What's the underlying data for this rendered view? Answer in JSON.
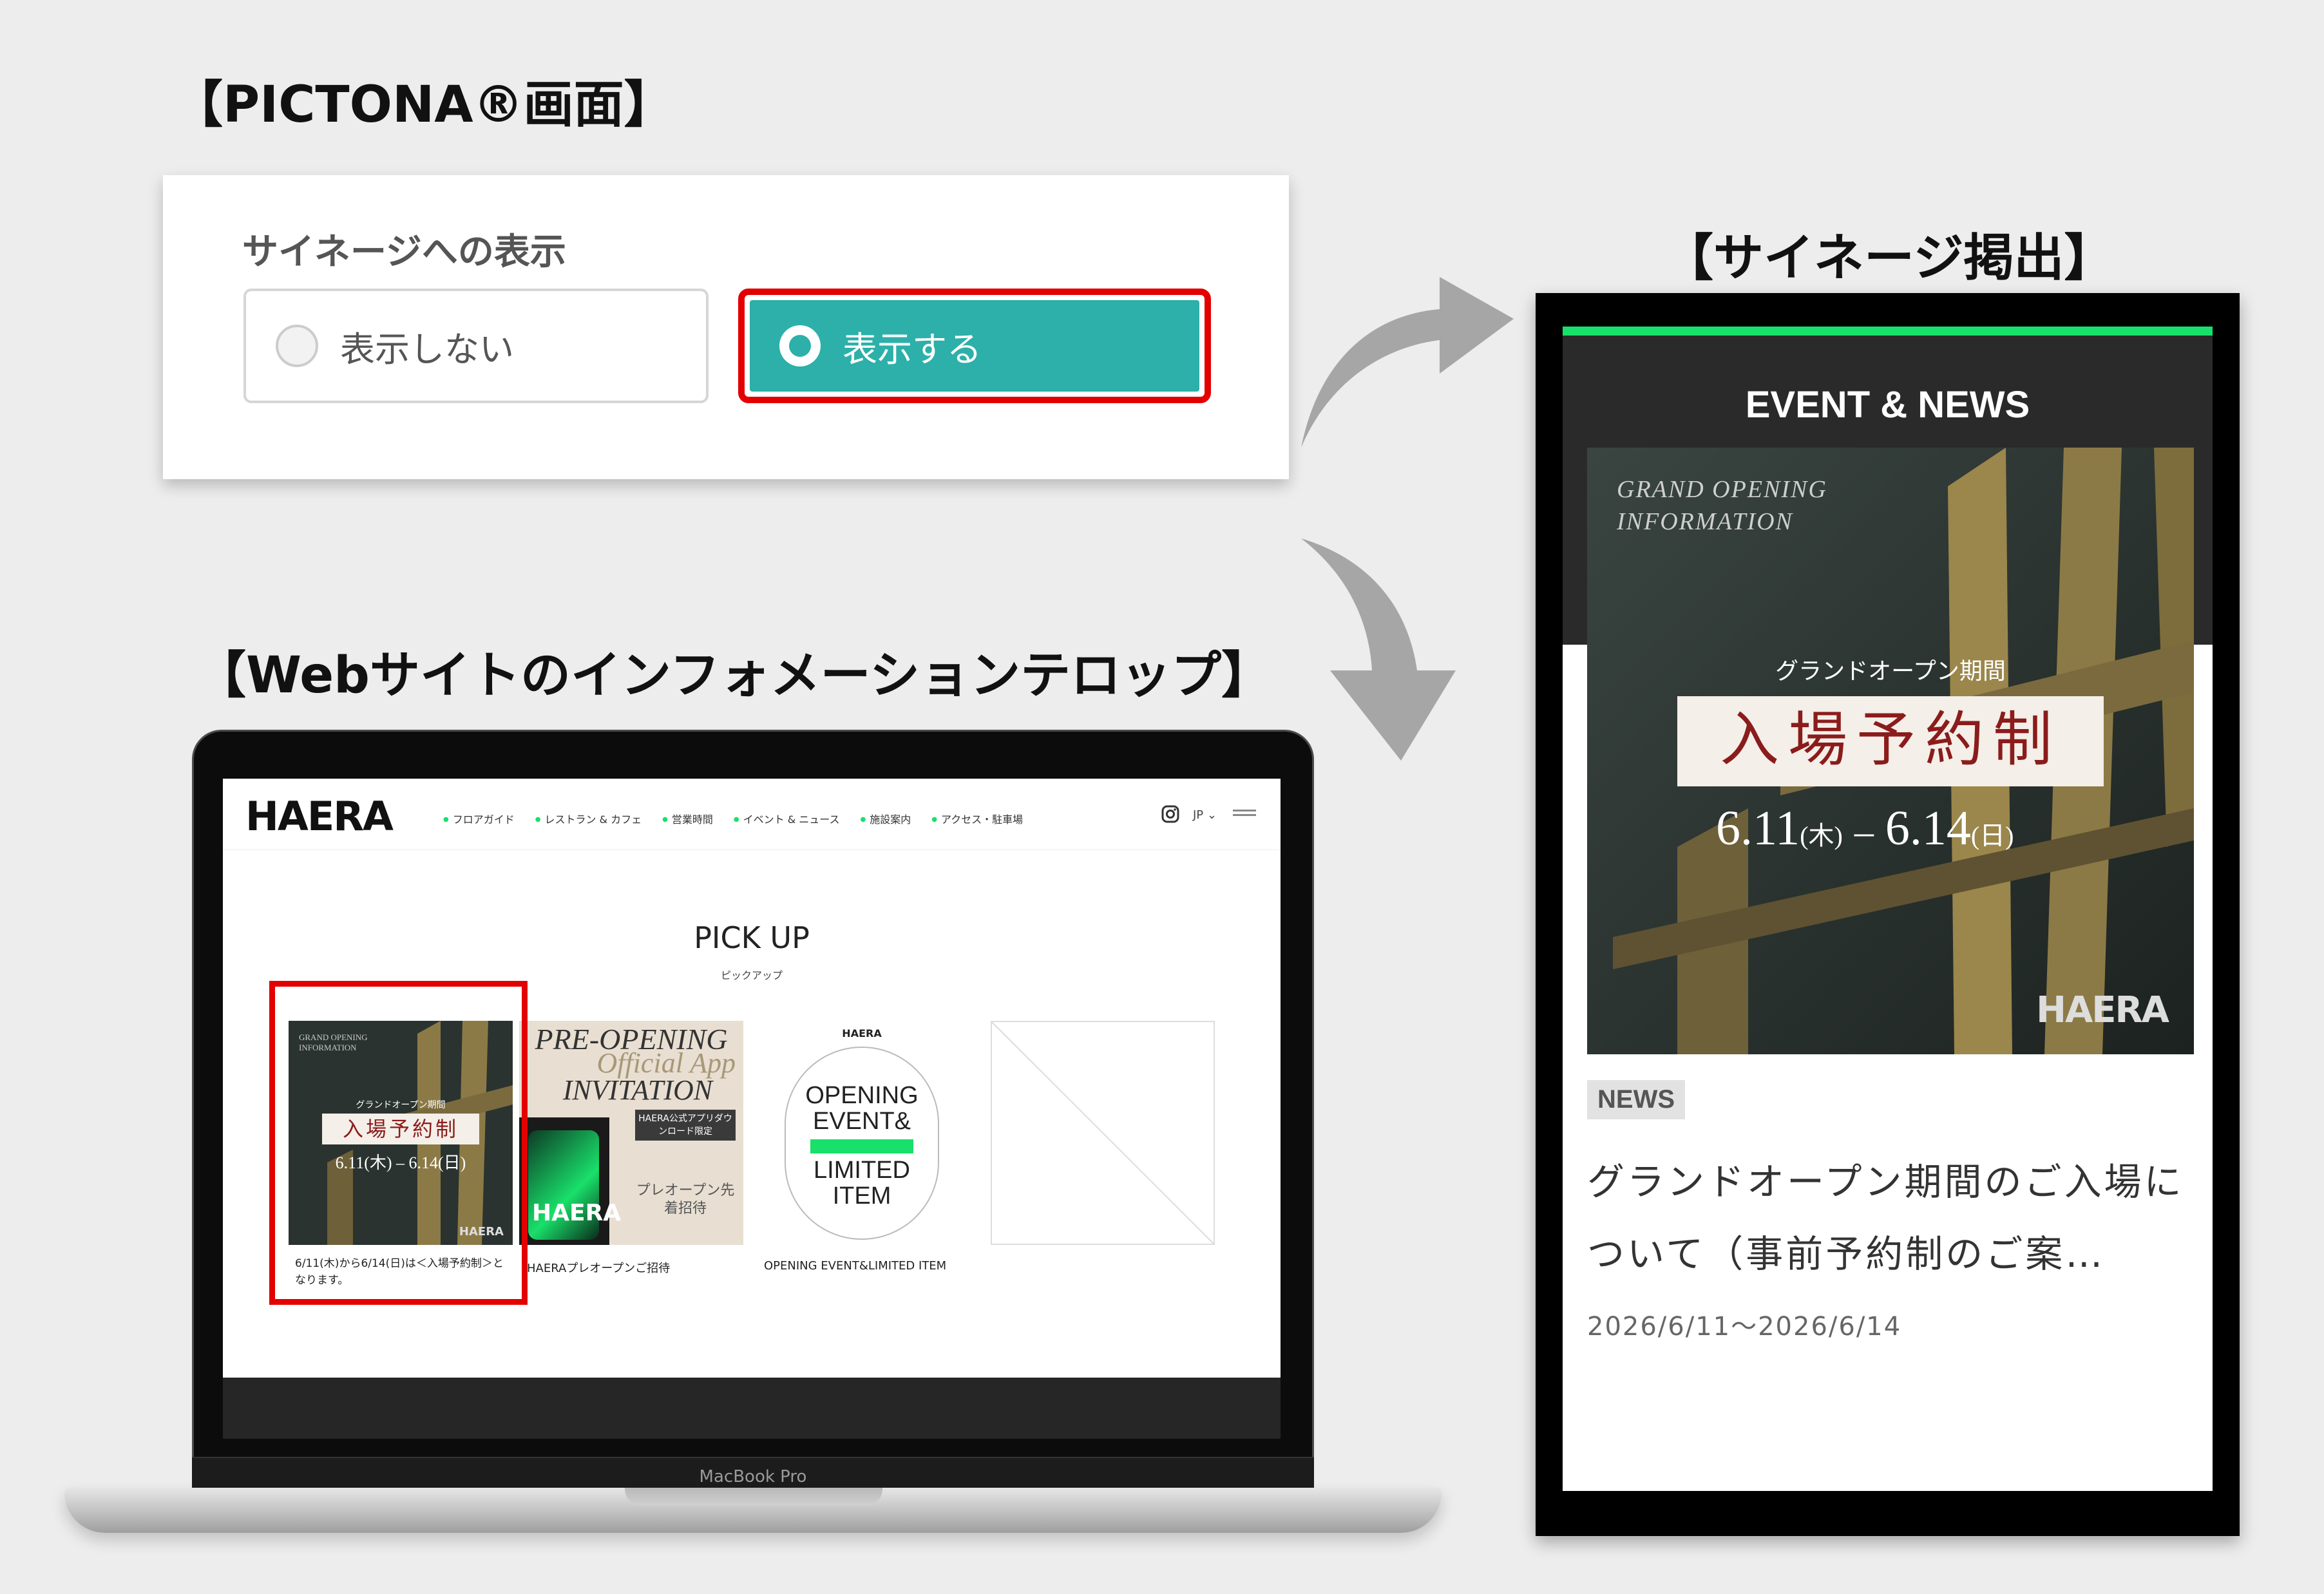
{
  "headings": {
    "pictona": "【PICTONA®画面】",
    "signage": "【サイネージ掲出】",
    "website": "【Webサイトのインフォメーションテロップ】"
  },
  "pictona_panel": {
    "title": "サイネージへの表示",
    "option_off": "表示しない",
    "option_on": "表示する",
    "selected": "表示する"
  },
  "website": {
    "logo": "HAERA",
    "nav": [
      "フロアガイド",
      "レストラン & カフェ",
      "営業時間",
      "イベント & ニュース",
      "施設案内",
      "アクセス・駐車場"
    ],
    "lang": "JP",
    "pickup_title": "PICK UP",
    "pickup_sub": "ピックアップ",
    "cards": [
      {
        "caption": "6/11(木)から6/14(日)は＜入場予約制＞となります。",
        "img_top": "GRAND OPENING INFORMATION",
        "img_sub": "グランドオープン期間",
        "img_main": "入場予約制",
        "img_date": "6.11(木) – 6.14(日)",
        "img_logo": "HAERA"
      },
      {
        "caption": "HAERAプレオープンご招待",
        "line1": "PRE-OPENING",
        "line2": "Official App",
        "line3": "INVITATION",
        "tag": "HAERA公式アプリダウンロード限定",
        "invite": "プレオープン先着招待",
        "logo": "HAERA"
      },
      {
        "caption": "OPENING EVENT&LIMITED ITEM",
        "logo": "HAERA",
        "line1": "OPENING",
        "line2": "EVENT&",
        "line3": "LIMITED",
        "line4": "ITEM"
      }
    ],
    "device_label": "MacBook Pro"
  },
  "signage": {
    "header": "EVENT & NEWS",
    "img_top_line1": "GRAND OPENING",
    "img_top_line2": "INFORMATION",
    "img_sub": "グランドオープン期間",
    "img_main": "入場予約制",
    "img_date_1": "6.11",
    "img_day_1": "(木)",
    "img_dash": "–",
    "img_date_2": "6.14",
    "img_day_2": "(日)",
    "img_logo": "HAERA",
    "badge": "NEWS",
    "title": "グランドオープン期間のご入場について（事前予約制のご案…",
    "date": "2026/6/11〜2026/6/14"
  },
  "colors": {
    "accent_teal": "#2cb0a9",
    "highlight_red": "#e30000",
    "neon_green": "#19e06a",
    "dark_red_text": "#8b1c1c"
  }
}
